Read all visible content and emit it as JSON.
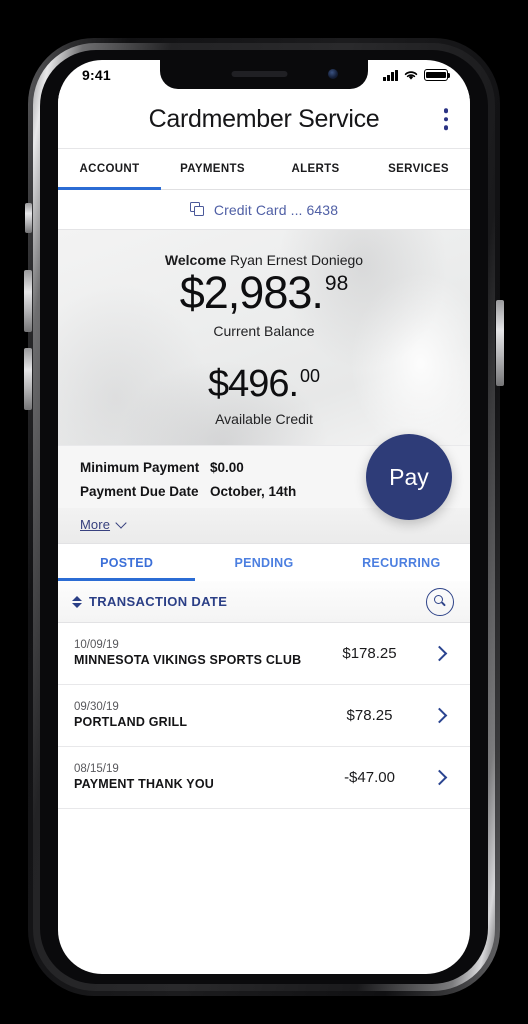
{
  "status_bar": {
    "time": "9:41",
    "signal_icon": "cellular-signal-icon",
    "wifi_icon": "wifi-icon",
    "battery_icon": "battery-full-icon"
  },
  "header": {
    "title": "Cardmember Service",
    "menu_icon": "kebab-menu-icon"
  },
  "top_tabs": [
    {
      "label": "ACCOUNT",
      "active": true
    },
    {
      "label": "PAYMENTS",
      "active": false
    },
    {
      "label": "ALERTS",
      "active": false
    },
    {
      "label": "SERVICES",
      "active": false
    }
  ],
  "card_selector": {
    "icon": "cards-stack-icon",
    "label": "Credit Card ... 6438"
  },
  "hero": {
    "welcome_label": "Welcome",
    "customer_name": "Ryan Ernest Doniego",
    "current_balance": {
      "whole": "$2,983.",
      "cents": "98",
      "caption": "Current Balance"
    },
    "available_credit": {
      "whole": "$496.",
      "cents": "00",
      "caption": "Available Credit"
    }
  },
  "payment_info": {
    "minimum_payment_label": "Minimum Payment",
    "minimum_payment_value": "$0.00",
    "due_date_label": "Payment Due Date",
    "due_date_value": "October, 14th",
    "more_label": "More",
    "more_icon": "chevron-down-icon",
    "pay_button_label": "Pay"
  },
  "txn_tabs": [
    {
      "label": "POSTED",
      "active": true
    },
    {
      "label": "PENDING",
      "active": false
    },
    {
      "label": "RECURRING",
      "active": false
    }
  ],
  "sort_bar": {
    "title": "TRANSACTION DATE",
    "sort_icon": "sort-updown-icon",
    "search_icon": "search-icon"
  },
  "transactions": [
    {
      "date": "10/09/19",
      "name": "MINNESOTA VIKINGS SPORTS CLUB",
      "amount": "$178.25",
      "chevron": "chevron-right-icon"
    },
    {
      "date": "09/30/19",
      "name": "PORTLAND GRILL",
      "amount": "$78.25",
      "chevron": "chevron-right-icon"
    },
    {
      "date": "08/15/19",
      "name": "PAYMENT THANK YOU",
      "amount": "-$47.00",
      "chevron": "chevron-right-icon"
    }
  ],
  "colors": {
    "accent_blue": "#2b6cd4",
    "navy": "#2e3c78",
    "link_blue": "#4f5fa5",
    "tab_blue": "#4c7fe0"
  }
}
